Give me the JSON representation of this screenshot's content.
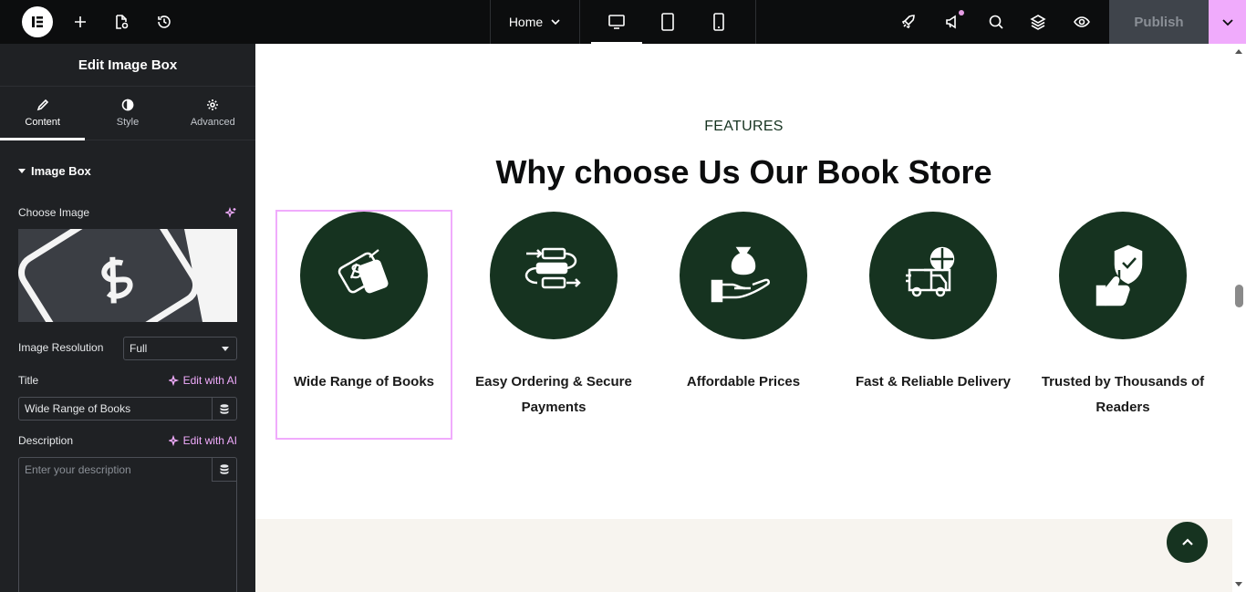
{
  "topbar": {
    "page_name": "Home",
    "publish_label": "Publish",
    "icons": [
      "elementor-logo-icon",
      "add-icon",
      "page-settings-icon",
      "history-icon",
      "desktop-icon",
      "tablet-icon",
      "mobile-icon",
      "rocket-icon",
      "megaphone-icon",
      "search-icon",
      "layers-icon",
      "eye-icon",
      "chevron-down-icon"
    ]
  },
  "panel": {
    "title": "Edit Image Box",
    "tabs": [
      {
        "label": "Content"
      },
      {
        "label": "Style"
      },
      {
        "label": "Advanced"
      }
    ],
    "section_title": "Image Box",
    "choose_image_label": "Choose Image",
    "image_resolution_label": "Image Resolution",
    "image_resolution_value": "Full",
    "title_label": "Title",
    "title_value": "Wide Range of Books",
    "description_label": "Description",
    "description_placeholder": "Enter your description",
    "ai_link": "Edit with AI"
  },
  "canvas": {
    "eyebrow": "FEATURES",
    "heading": "Why choose Us Our Book Store",
    "features": [
      {
        "title": "Wide Range of Books",
        "icon": "price-tag-icon"
      },
      {
        "title": "Easy Ordering & Secure Payments",
        "icon": "process-flow-icon"
      },
      {
        "title": "Affordable Prices",
        "icon": "money-hand-icon"
      },
      {
        "title": "Fast & Reliable Delivery",
        "icon": "delivery-truck-icon"
      },
      {
        "title": "Trusted by Thousands of Readers",
        "icon": "trust-shield-icon"
      }
    ]
  },
  "colors": {
    "accent": "#f0abfc",
    "feature_green": "#163320",
    "panel_bg": "#1f2124",
    "topbar_bg": "#0c0d0e"
  }
}
